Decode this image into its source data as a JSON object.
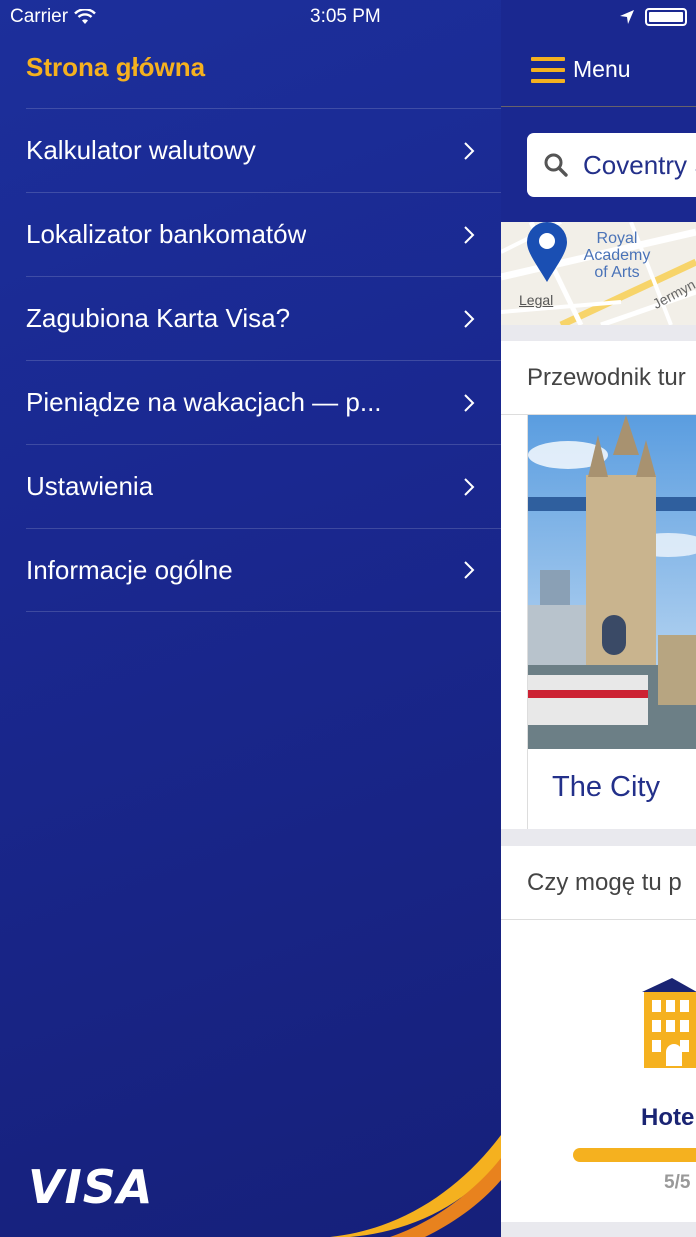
{
  "status_bar": {
    "carrier": "Carrier",
    "time": "3:05 PM"
  },
  "drawer": {
    "title": "Strona główna",
    "items": [
      {
        "label": "Kalkulator walutowy"
      },
      {
        "label": "Lokalizator bankomatów"
      },
      {
        "label": "Zagubiona Karta Visa?"
      },
      {
        "label": "Pieniądze na wakacjach — p..."
      },
      {
        "label": "Ustawienia"
      },
      {
        "label": "Informacje ogólne"
      }
    ],
    "logo": "VISA"
  },
  "main": {
    "menu_label": "Menu",
    "search": {
      "value": "Coventry S"
    },
    "map": {
      "poi_label_lines": [
        "Royal",
        "Academy",
        "of Arts"
      ],
      "legal": "Legal",
      "street": "Jermyn"
    },
    "guide_card": {
      "header": "Przewodnik tur",
      "city": "The City"
    },
    "pay_card": {
      "header": "Czy mogę tu p",
      "category": "Hote",
      "rating_text": "5/5",
      "rating_fraction": 1.0
    }
  },
  "colors": {
    "drawer_bg": "#1a2890",
    "accent": "#f5b11f",
    "text_on_dark": "#ffffff",
    "brand_text": "#23308a"
  }
}
